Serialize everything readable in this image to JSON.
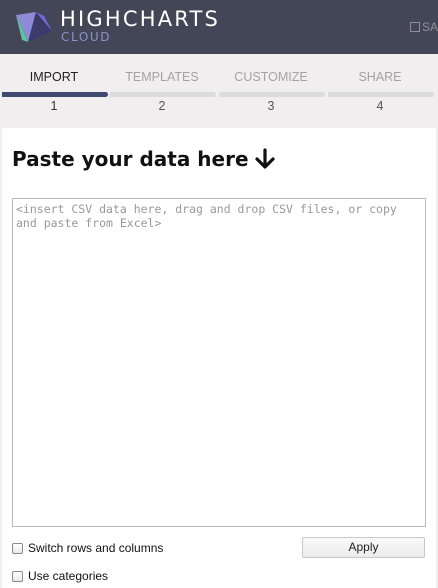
{
  "header": {
    "brand": "HIGHCHARTS",
    "brand_sub": "CLOUD",
    "save_label": "SA"
  },
  "steps": [
    {
      "label": "IMPORT",
      "number": "1",
      "active": true
    },
    {
      "label": "TEMPLATES",
      "number": "2",
      "active": false
    },
    {
      "label": "CUSTOMIZE",
      "number": "3",
      "active": false
    },
    {
      "label": "SHARE",
      "number": "4",
      "active": false
    }
  ],
  "import": {
    "title": "Paste your data here",
    "data_value": "",
    "data_placeholder": "<insert CSV data here, drag and drop CSV files, or copy and paste from Excel>",
    "switch_label": "Switch rows and columns",
    "switch_checked": false,
    "categories_label": "Use categories",
    "categories_checked": false,
    "apply_label": "Apply"
  },
  "colors": {
    "header_bg": "#434656",
    "accent": "#3f4a6f",
    "brand_sub": "#8b93c9"
  }
}
